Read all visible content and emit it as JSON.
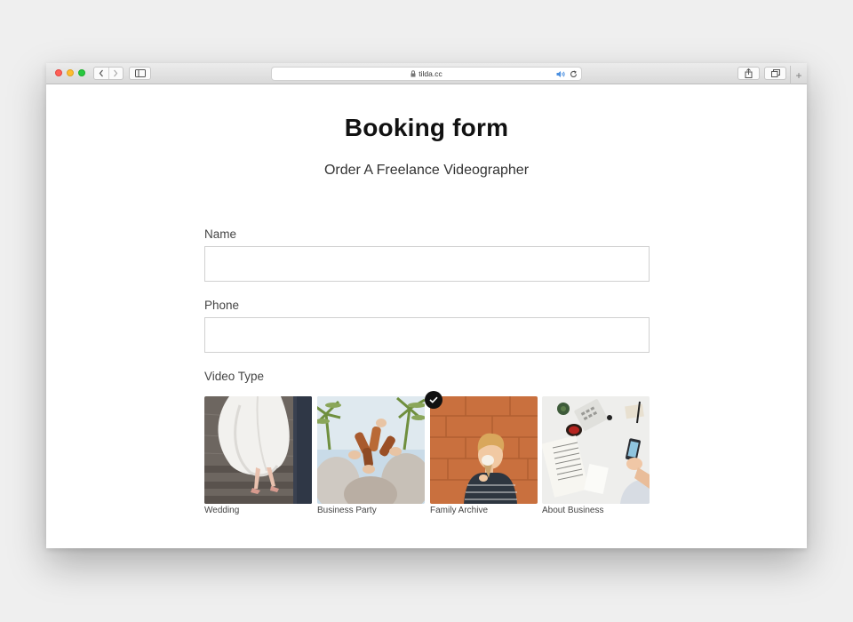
{
  "browser": {
    "url": "tilda.cc",
    "icons": {
      "close": "close-dot",
      "minimize": "minimize-dot",
      "maximize": "maximize-dot",
      "back": "chevron-left-icon",
      "forward": "chevron-right-icon",
      "sidebar": "sidebar-icon",
      "lock": "lock-icon",
      "audio": "speaker-icon",
      "reload": "reload-icon",
      "share": "share-icon",
      "tabs": "tabs-icon",
      "new_tab": "plus-icon"
    },
    "new_tab_glyph": "+"
  },
  "page": {
    "title": "Booking form",
    "subtitle": "Order A Freelance Videographer"
  },
  "form": {
    "name_label": "Name",
    "name_value": "",
    "phone_label": "Phone",
    "phone_value": "",
    "video_type_label": "Video Type",
    "video_types": [
      {
        "label": "Wedding",
        "selected": false,
        "image": "wedding-photo"
      },
      {
        "label": "Business Party",
        "selected": false,
        "image": "party-toast-photo"
      },
      {
        "label": "Family Archive",
        "selected": true,
        "image": "child-with-ice-cream-photo"
      },
      {
        "label": "About Business",
        "selected": false,
        "image": "office-desk-photo"
      }
    ]
  },
  "colors": {
    "accent_check": "#111111",
    "traffic_red": "#ff5f57",
    "traffic_yellow": "#febc2e",
    "traffic_green": "#28c840"
  }
}
